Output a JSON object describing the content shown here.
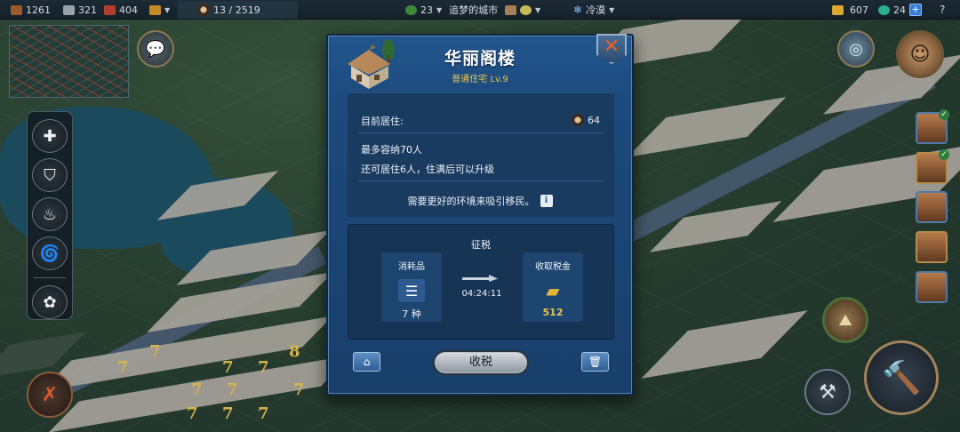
{
  "topbar": {
    "wood": "1261",
    "stone": "321",
    "brick": "404",
    "population": "13 / 2519",
    "level": "23",
    "title": "追梦的城市",
    "weather": "冷漠",
    "gold": "607",
    "gems": "24",
    "add_label": "+",
    "help_label": "?"
  },
  "dialog": {
    "title": "华丽阁楼",
    "subtitle": "普通住宅 Lv.9",
    "current_residents_label": "目前居住:",
    "current_residents_value": "64",
    "max_capacity": "最多容纳70人",
    "upgrade_hint": "还可居住6人，住满后可以升级",
    "environment_note": "需要更好的环境来吸引移民。",
    "info_icon": "i",
    "tax": {
      "title": "征税",
      "consumables_label": "消耗品",
      "consumables_value": "7 种",
      "timer": "04:24:11",
      "income_label": "收取税金",
      "income_value": "512"
    },
    "collect_button": "收税",
    "close_icon": "✕"
  },
  "map_numbers": [
    "7",
    "7",
    "7",
    "7",
    "7",
    "7",
    "7",
    "8",
    "7",
    "7",
    "7"
  ],
  "colors": {
    "dialog_bg": "#1c4a7d",
    "gold_text": "#e8c34b",
    "close_x": "#e8602c"
  },
  "icons": {
    "left_tools": [
      "plus-icon",
      "shield-icon",
      "flame-icon",
      "tornado-icon",
      "tulip-icon"
    ],
    "right_tools": [
      "globe-icon",
      "map-icon",
      "shovel-icon",
      "hammer-icon"
    ]
  }
}
